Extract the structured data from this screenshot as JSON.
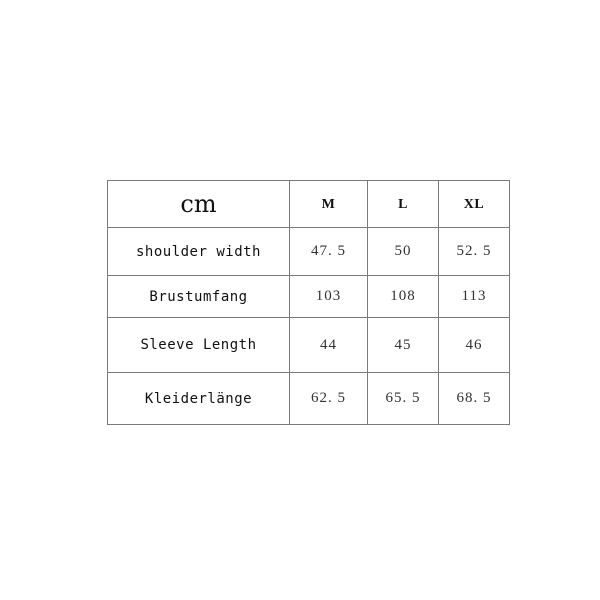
{
  "table": {
    "unit_label": "cm",
    "sizes": [
      "M",
      "L",
      "XL"
    ],
    "rows": [
      {
        "label": "shoulder width",
        "values": [
          "47. 5",
          "50",
          "52. 5"
        ]
      },
      {
        "label": "Brustumfang",
        "values": [
          "103",
          "108",
          "113"
        ]
      },
      {
        "label": "Sleeve Length",
        "values": [
          "44",
          "45",
          "46"
        ]
      },
      {
        "label": "Kleiderlänge",
        "values": [
          "62. 5",
          "65. 5",
          "68. 5"
        ]
      }
    ]
  }
}
